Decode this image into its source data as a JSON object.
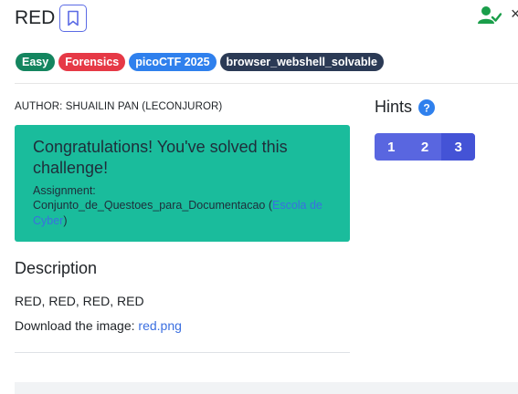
{
  "header": {
    "title": "RED",
    "close_glyph": "×"
  },
  "tags": [
    "Easy",
    "Forensics",
    "picoCTF 2025",
    "browser_webshell_solvable"
  ],
  "author": "AUTHOR: SHUAILIN PAN (LECONJUROR)",
  "congrats": {
    "title": "Congratulations! You've solved this challenge!",
    "assignment_label": "Assignment:",
    "assignment_name": "Conjunto_de_Questoes_para_Documentacao (",
    "assignment_link": "Escola de Cyber",
    "assignment_suffix": ")"
  },
  "hints": {
    "label": "Hints",
    "buttons": [
      "1",
      "2",
      "3"
    ]
  },
  "description": {
    "heading": "Description",
    "text": "RED, RED, RED, RED",
    "download_prefix": "Download the image: ",
    "download_link": "red.png"
  },
  "colors": {
    "accent": "#5966e0",
    "success": "#1abc9c",
    "solved_icon": "#1a9e4a"
  }
}
